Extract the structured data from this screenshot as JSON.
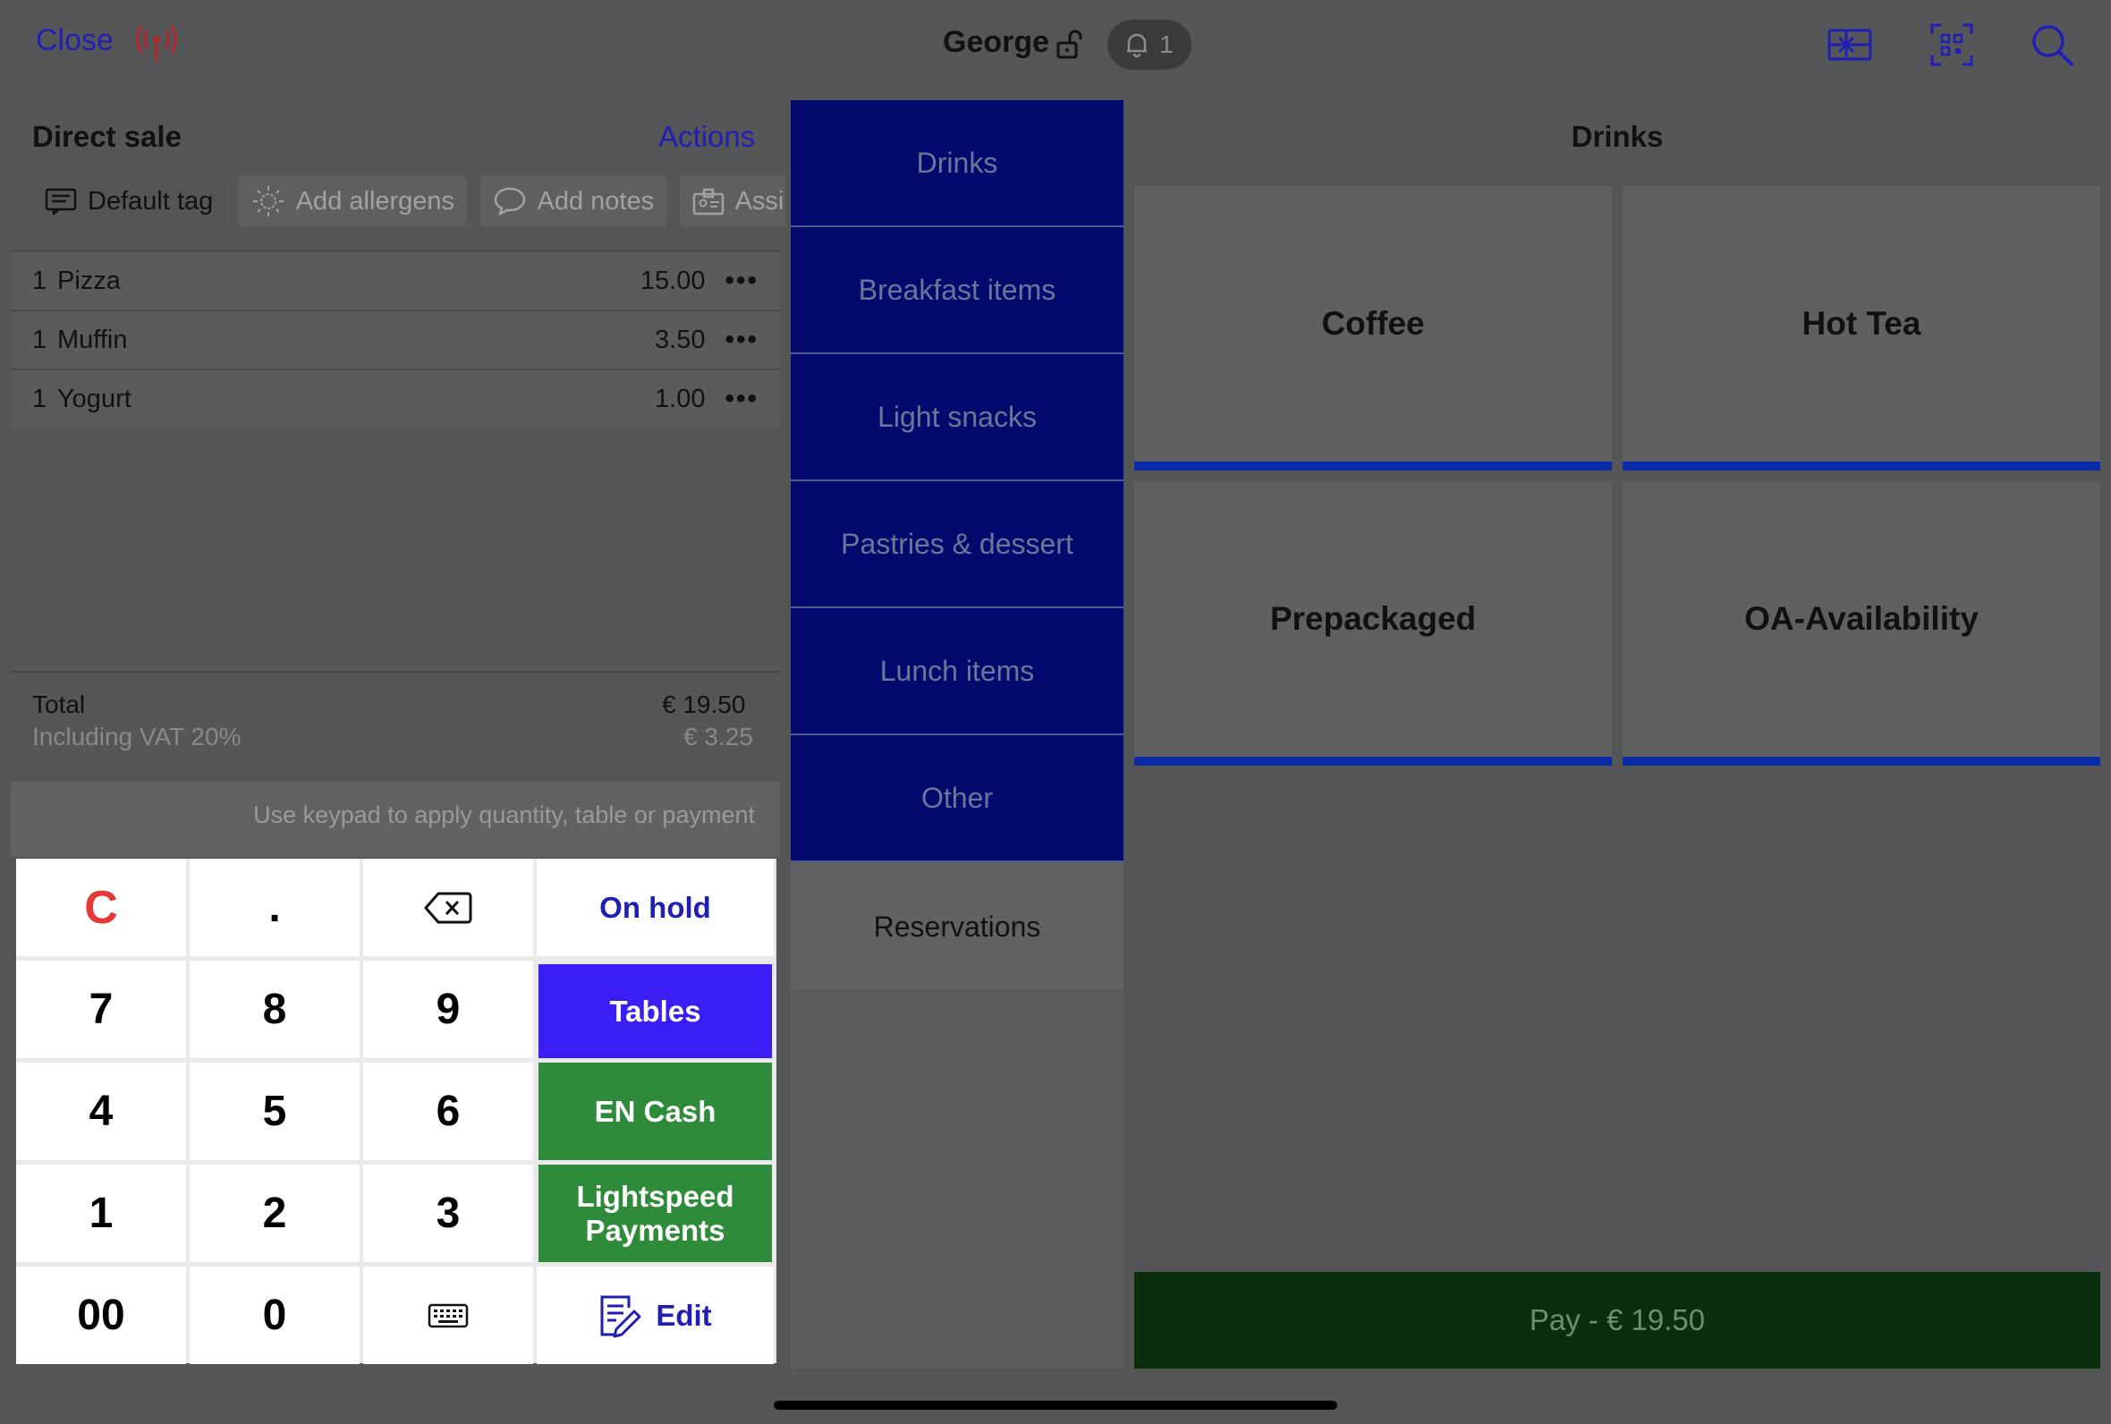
{
  "header": {
    "close_label": "Close",
    "user_name": "George",
    "notification_count": "1"
  },
  "ticket": {
    "title": "Direct sale",
    "actions_label": "Actions",
    "chips": [
      "Default tag",
      "Add allergens",
      "Add notes",
      "Assi"
    ],
    "lines": [
      {
        "qty": "1",
        "name": "Pizza",
        "price": "15.00"
      },
      {
        "qty": "1",
        "name": "Muffin",
        "price": "3.50"
      },
      {
        "qty": "1",
        "name": "Yogurt",
        "price": "1.00"
      }
    ],
    "more_glyph": "•••",
    "total_label": "Total",
    "total_value": "€ 19.50",
    "vat_label": "Including VAT 20%",
    "vat_value": "€ 3.25",
    "hint": "Use keypad to apply quantity, table or payment"
  },
  "keypad": {
    "clear": "C",
    "dot": ".",
    "on_hold": "On hold",
    "k7": "7",
    "k8": "8",
    "k9": "9",
    "tables": "Tables",
    "k4": "4",
    "k5": "5",
    "k6": "6",
    "cash": "EN Cash",
    "k1": "1",
    "k2": "2",
    "k3": "3",
    "lightspeed_line1": "Lightspeed",
    "lightspeed_line2": "Payments",
    "k00": "00",
    "k0": "0",
    "edit": "Edit"
  },
  "categories": [
    "Drinks",
    "Breakfast items",
    "Light snacks",
    "Pastries & dessert",
    "Lunch items",
    "Other",
    "Reservations"
  ],
  "products": {
    "title": "Drinks",
    "items": [
      "Coffee",
      "Hot Tea",
      "Prepackaged",
      "OA-Availability"
    ]
  },
  "pay_label": "Pay - € 19.50",
  "colors": {
    "accent_blue": "#1f1fb4",
    "category_blue": "#020a6e",
    "tables_blue": "#3a1ff5",
    "payment_green": "#2e8b3a",
    "pay_dark_green": "#0b2e0f",
    "clear_red": "#e53838"
  },
  "icons": [
    "signal-icon",
    "lock-icon",
    "bell-icon",
    "gift-card-icon",
    "qr-scan-icon",
    "search-icon",
    "tag-icon",
    "allergen-icon",
    "notes-icon",
    "assign-icon",
    "backspace-icon",
    "keyboard-icon",
    "edit-icon"
  ]
}
